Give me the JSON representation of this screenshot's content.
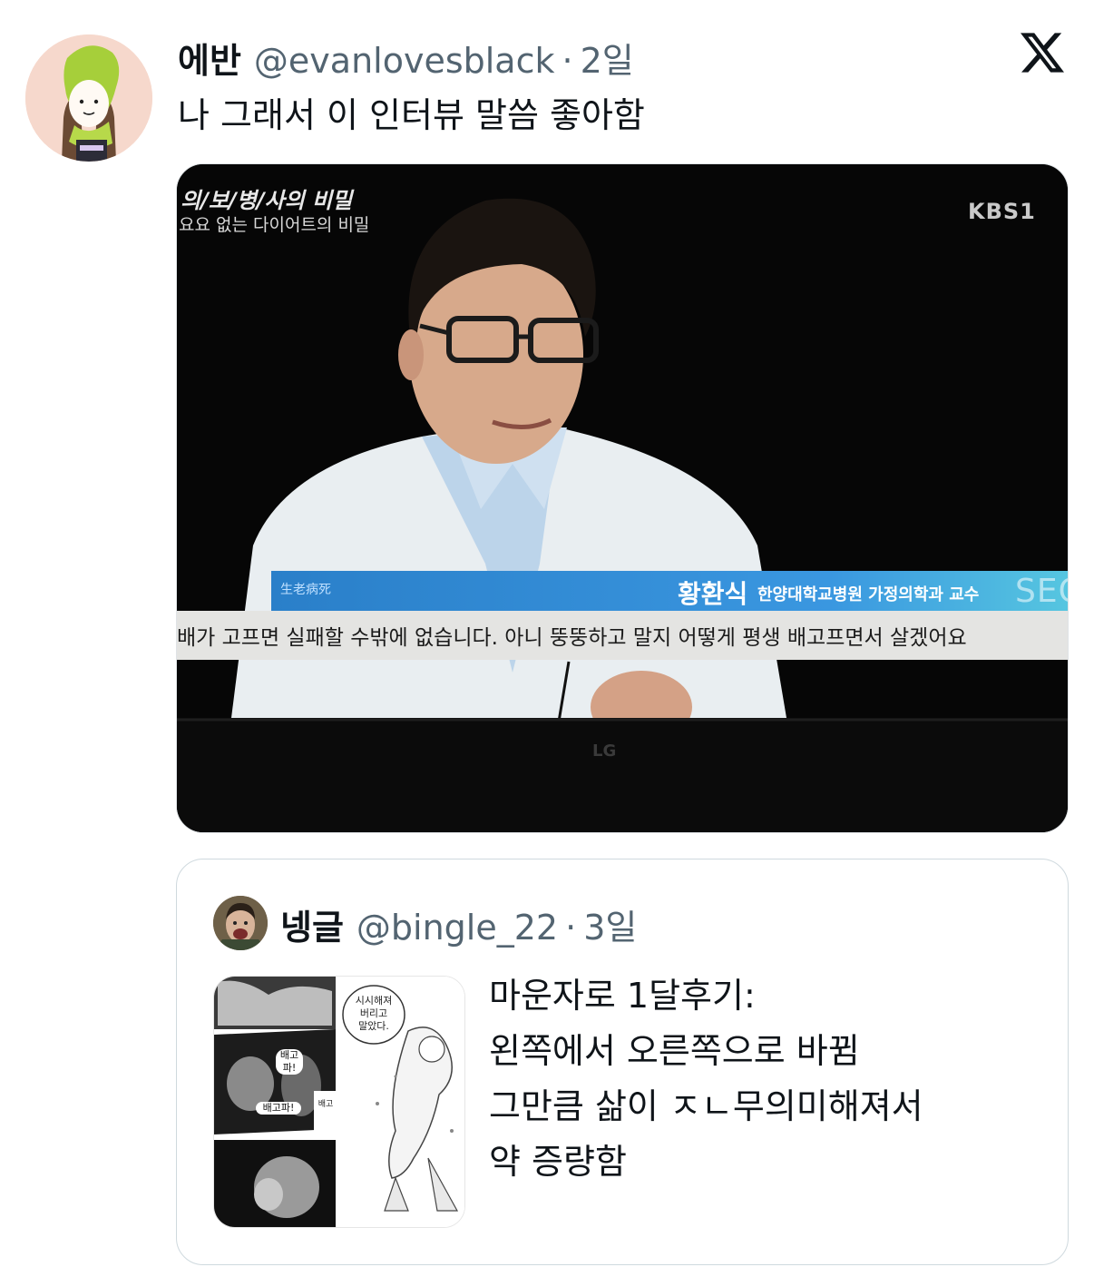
{
  "tweet": {
    "author_name": "에반",
    "author_handle": "@evanlovesblack",
    "separator": "·",
    "time": "2일",
    "text": "나 그래서 이 인터뷰 말씀 좋아함"
  },
  "platform_icon": "x-logo-icon",
  "media": {
    "program_title": "의/보/병/사의 비밀",
    "program_subtitle": "요요 없는 다이어트의 비밀",
    "channel": "KBS1",
    "lower_third_tag": "生老病死",
    "speaker_name": "황환식",
    "speaker_role": "한양대학교병원 가정의학과 교수",
    "watermark": "SECRET",
    "caption": "배가 고프면 실패할 수밖에 없습니다. 아니 뚱뚱하고 말지 어떻게 평생 배고프면서 살겠어요",
    "tv_brand": "LG"
  },
  "quoted_tweet": {
    "author_name": "넹글",
    "author_handle": "@bingle_22",
    "separator": "·",
    "time": "3일",
    "lines": [
      "마운자로 1달후기:",
      "왼쪽에서 오른쪽으로 바뀜",
      "그만큼 삶이 ㅈㄴ무의미해져서",
      "약 증량함"
    ],
    "manga_bubbles": {
      "right": "시시해져\n버리고\n말았다.",
      "left_1": "배고\n파!",
      "left_2": "배고파!",
      "left_3": "배고"
    }
  },
  "colors": {
    "text_primary": "#0f1419",
    "text_secondary": "#536471",
    "border": "#cfd9de",
    "lower_third_blue": "#3a97e0"
  }
}
